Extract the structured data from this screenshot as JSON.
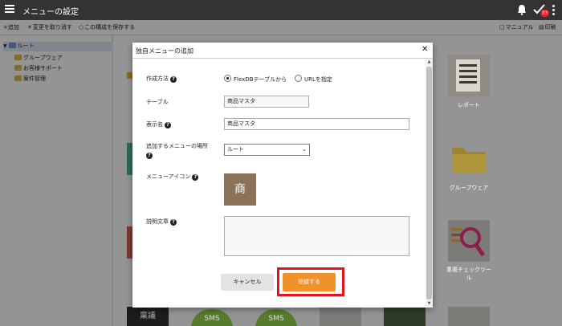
{
  "header": {
    "title": "メニューの設定",
    "notification_badge": "33"
  },
  "toolbar": {
    "add_label": "+追加",
    "discard_label": "変更を取り消す",
    "save_config_label": "この構成を保存する",
    "manual_label": "マニュアル",
    "print_label": "印刷"
  },
  "sidebar": {
    "root_label": "ルート",
    "items": [
      {
        "label": "グループウェア"
      },
      {
        "label": "お客様サポート"
      },
      {
        "label": "案件管理"
      }
    ]
  },
  "tiles": {
    "report_label": "レポート",
    "groupware_label": "グループウェア",
    "duplicate_check_label_line1": "重複チェックツー",
    "duplicate_check_label_line2": "ル",
    "sms_label": "SMS",
    "bottom_text": "稟議"
  },
  "modal": {
    "title": "独自メニューの追加",
    "creation_method_label": "作成方法",
    "option_flexdb": "FlexDBテーブルから",
    "option_url": "URLを指定",
    "selected_option": "FlexDBテーブルから",
    "table_label": "テーブル",
    "table_value": "商品マスタ",
    "display_name_label": "表示名",
    "display_name_value": "商品マスタ",
    "location_label": "追加するメニューの場所",
    "location_value": "ルート",
    "menu_icon_label": "メニューアイコン",
    "menu_icon_char": "商",
    "description_label": "説明文章",
    "description_value": "",
    "cancel_label": "キャンセル",
    "register_label": "登録する"
  },
  "colors": {
    "register_button": "#f0922b",
    "highlight": "#e3131b",
    "icon_bg": "#8b735a",
    "topbar": "#333333"
  }
}
